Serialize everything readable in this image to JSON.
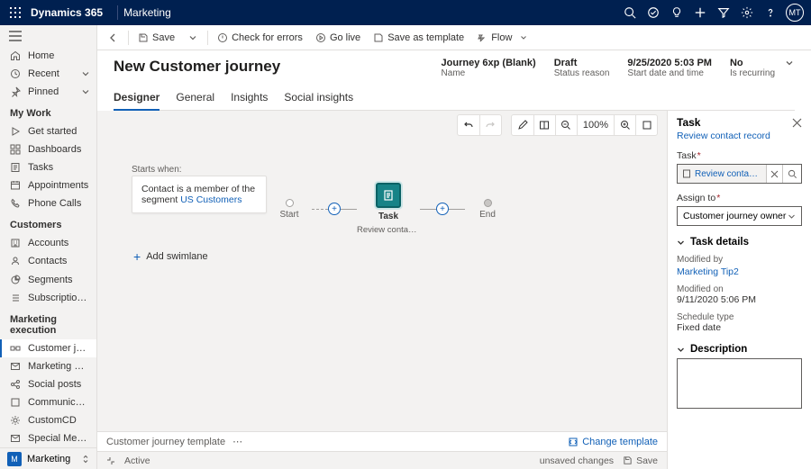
{
  "topbar": {
    "brand": "Dynamics 365",
    "module": "Marketing",
    "avatar": "MT"
  },
  "sidebar": {
    "home": "Home",
    "recent": "Recent",
    "pinned": "Pinned",
    "group_mywork": "My Work",
    "get_started": "Get started",
    "dashboards": "Dashboards",
    "tasks": "Tasks",
    "appointments": "Appointments",
    "phone_calls": "Phone Calls",
    "group_customers": "Customers",
    "accounts": "Accounts",
    "contacts": "Contacts",
    "segments": "Segments",
    "subscription_lists": "Subscription lists",
    "group_execution": "Marketing execution",
    "customer_journeys": "Customer journeys",
    "marketing_emails": "Marketing emails",
    "social_posts": "Social posts",
    "communication_d": "Communication D…",
    "customcd": "CustomCD",
    "special_messages": "Special Messages",
    "area": "Marketing",
    "area_letter": "M"
  },
  "cmd": {
    "save": "Save",
    "check": "Check for errors",
    "golive": "Go live",
    "template": "Save as template",
    "flow": "Flow"
  },
  "header": {
    "title": "New Customer journey",
    "name_v": "Journey 6xp (Blank)",
    "name_l": "Name",
    "status_v": "Draft",
    "status_l": "Status reason",
    "start_v": "9/25/2020 5:03 PM",
    "start_l": "Start date and time",
    "recur_v": "No",
    "recur_l": "Is recurring"
  },
  "tabs": {
    "designer": "Designer",
    "general": "General",
    "insights": "Insights",
    "social": "Social insights"
  },
  "canvas": {
    "zoom": "100%",
    "starts_when": "Starts when:",
    "start_text1": "Contact is a member of the segment ",
    "start_link": "US Customers",
    "start_label": "Start",
    "task_label": "Task",
    "task_sub": "Review contact re…",
    "end_label": "End",
    "add_swimlane": "Add swimlane"
  },
  "footer": {
    "template": "Customer journey template",
    "change": "Change template"
  },
  "statusbar": {
    "active": "Active",
    "unsaved": "unsaved changes",
    "save": "Save"
  },
  "rpane": {
    "title": "Task",
    "subtitle": "Review contact record",
    "task_label": "Task",
    "task_value": "Review contact record",
    "assign_label": "Assign to",
    "assign_value": "Customer journey owner",
    "details": "Task details",
    "modby_l": "Modified by",
    "modby_v": "Marketing Tip2",
    "modon_l": "Modified on",
    "modon_v": "9/11/2020 5:06 PM",
    "sched_l": "Schedule type",
    "sched_v": "Fixed date",
    "desc": "Description"
  }
}
